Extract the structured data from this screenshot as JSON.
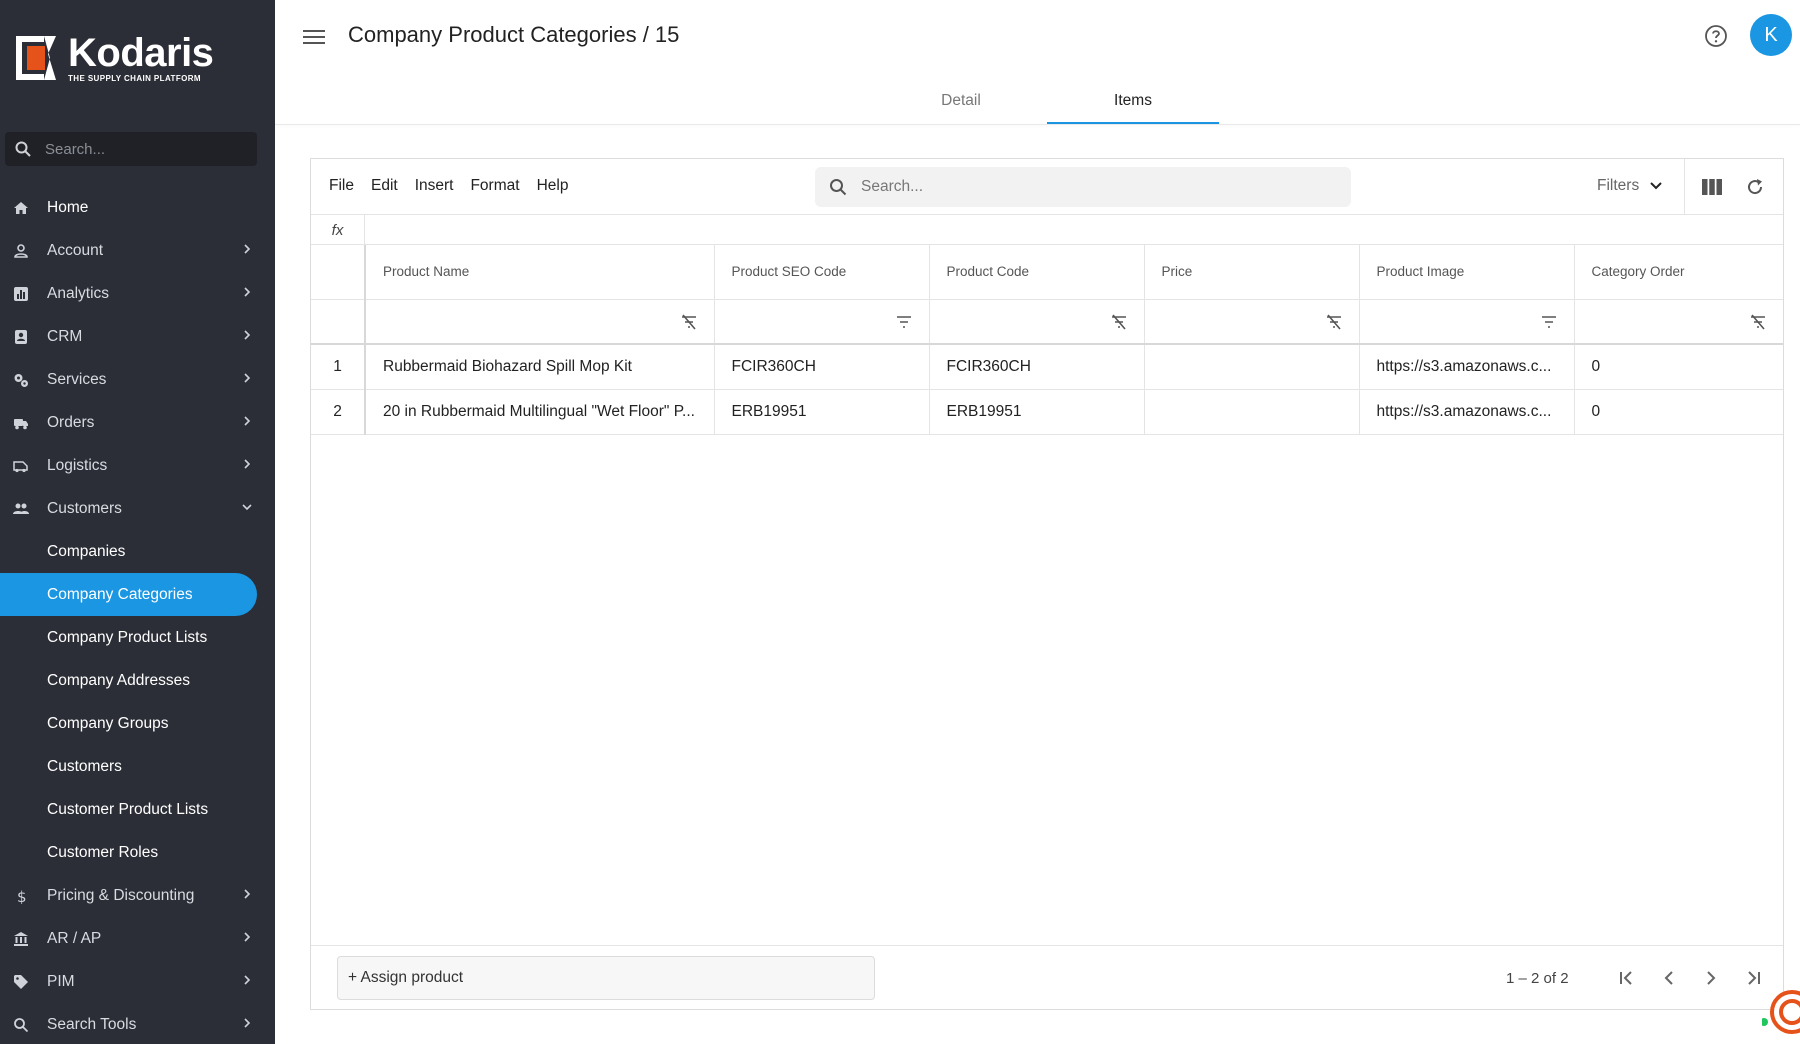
{
  "brand": {
    "name": "Kodaris",
    "tagline": "THE SUPPLY CHAIN PLATFORM",
    "accent": "#1b96e2",
    "logo_orange": "#e5531a"
  },
  "sidebar": {
    "search_placeholder": "Search...",
    "items": [
      {
        "label": "Home",
        "icon": "home-icon"
      },
      {
        "label": "Account",
        "icon": "person-icon"
      },
      {
        "label": "Analytics",
        "icon": "analytics-icon"
      },
      {
        "label": "CRM",
        "icon": "contact-card-icon"
      },
      {
        "label": "Services",
        "icon": "gears-icon"
      },
      {
        "label": "Orders",
        "icon": "truck-icon"
      },
      {
        "label": "Logistics",
        "icon": "van-icon"
      },
      {
        "label": "Customers",
        "icon": "people-icon"
      }
    ],
    "customer_subitems": [
      "Companies",
      "Company Categories",
      "Company Product Lists",
      "Company Addresses",
      "Company Groups",
      "Customers",
      "Customer Product Lists",
      "Customer Roles"
    ],
    "active_subitem": "Company Categories",
    "bottom_items": [
      {
        "label": "Pricing & Discounting",
        "icon": "dollar-icon"
      },
      {
        "label": "AR / AP",
        "icon": "bank-icon"
      },
      {
        "label": "PIM",
        "icon": "tag-icon"
      },
      {
        "label": "Search Tools",
        "icon": "search-icon"
      }
    ]
  },
  "header": {
    "title": "Company Product Categories / 15",
    "avatar_initial": "K"
  },
  "tabs": [
    {
      "label": "Detail",
      "active": false
    },
    {
      "label": "Items",
      "active": true
    }
  ],
  "toolbar": {
    "menu": [
      "File",
      "Edit",
      "Insert",
      "Format",
      "Help"
    ],
    "search_placeholder": "Search...",
    "filters_label": "Filters"
  },
  "formula_bar": {
    "label": "fx"
  },
  "grid": {
    "columns": [
      "Product Name",
      "Product SEO Code",
      "Product Code",
      "Price",
      "Product Image",
      "Category Order"
    ],
    "rows": [
      {
        "num": "1",
        "cells": [
          "Rubbermaid Biohazard Spill Mop Kit",
          "FCIR360CH",
          "FCIR360CH",
          "",
          "https://s3.amazonaws.c...",
          "0"
        ]
      },
      {
        "num": "2",
        "cells": [
          "20 in Rubbermaid Multilingual \"Wet Floor\" P...",
          "ERB19951",
          "ERB19951",
          "",
          "https://s3.amazonaws.c...",
          "0"
        ]
      }
    ]
  },
  "footer": {
    "assign_label": "+ Assign product",
    "pager_text": "1 – 2 of 2"
  }
}
